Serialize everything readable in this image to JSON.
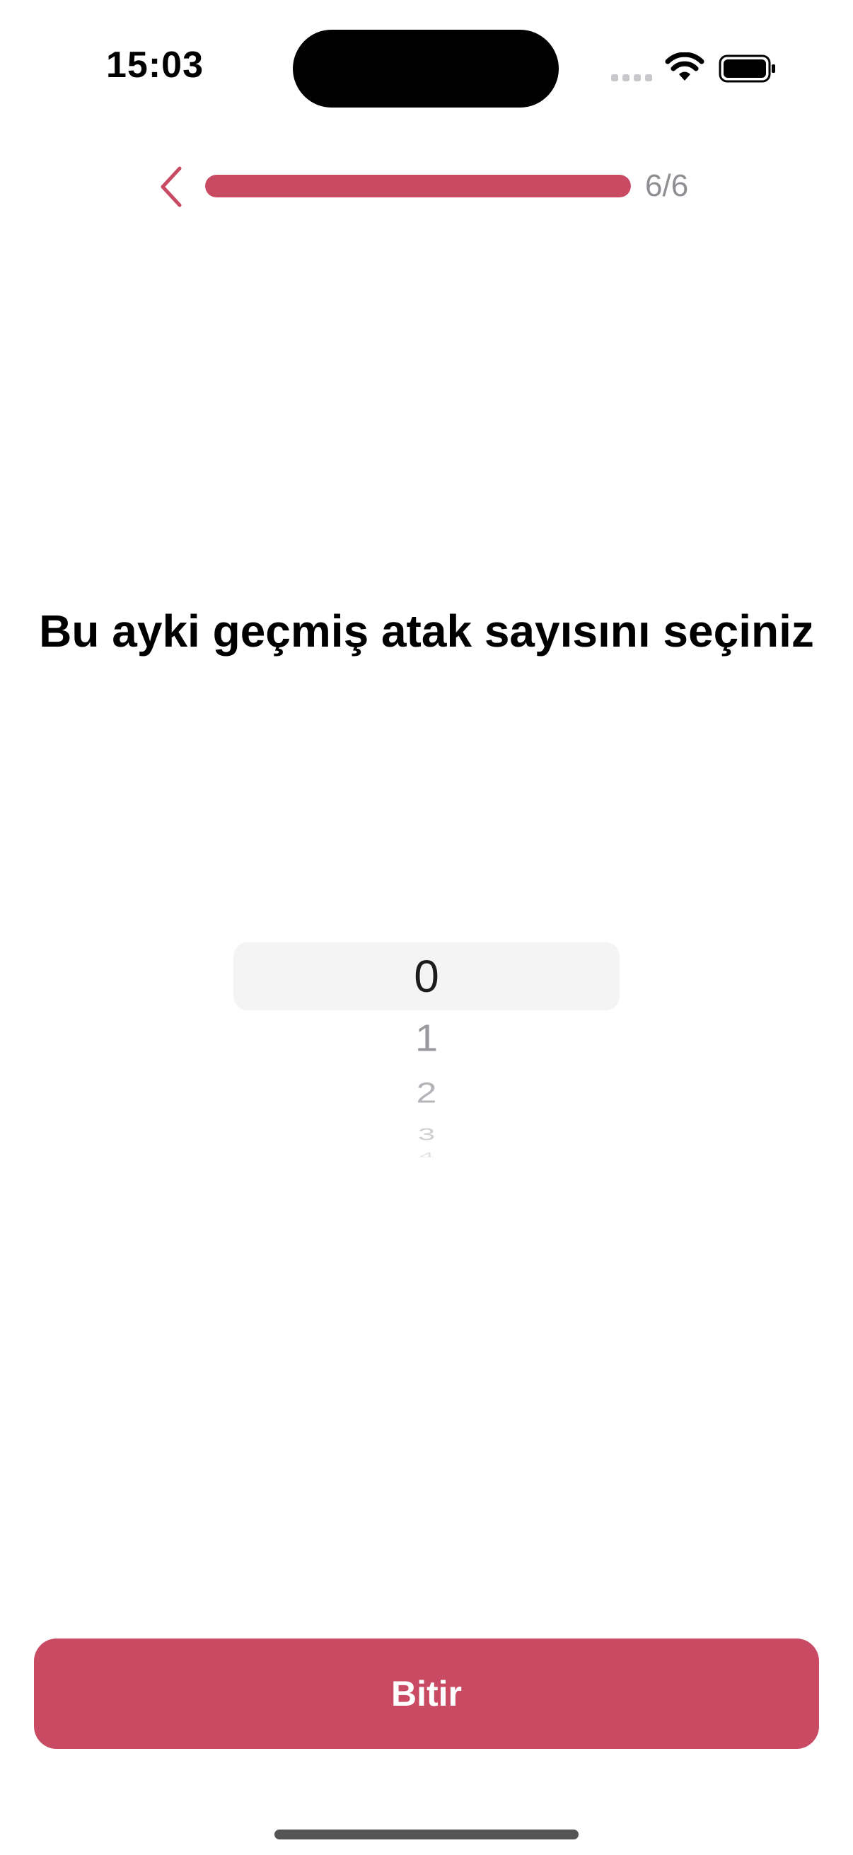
{
  "status_bar": {
    "time": "15:03",
    "icons": [
      "signal-icon",
      "wifi-icon",
      "battery-icon"
    ]
  },
  "header": {
    "back_icon": "chevron-left-icon",
    "progress_fraction": 1.0,
    "step_counter": "6/6"
  },
  "question": {
    "title": "Bu ayki geçmiş atak sayısını seçiniz"
  },
  "picker": {
    "selected": "0",
    "options": [
      "0",
      "1",
      "2",
      "3",
      "4"
    ]
  },
  "footer": {
    "finish_label": "Bitir"
  },
  "colors": {
    "accent": "#c94b63",
    "muted_text": "#8e8e93",
    "picker_highlight": "#f4f4f4"
  }
}
